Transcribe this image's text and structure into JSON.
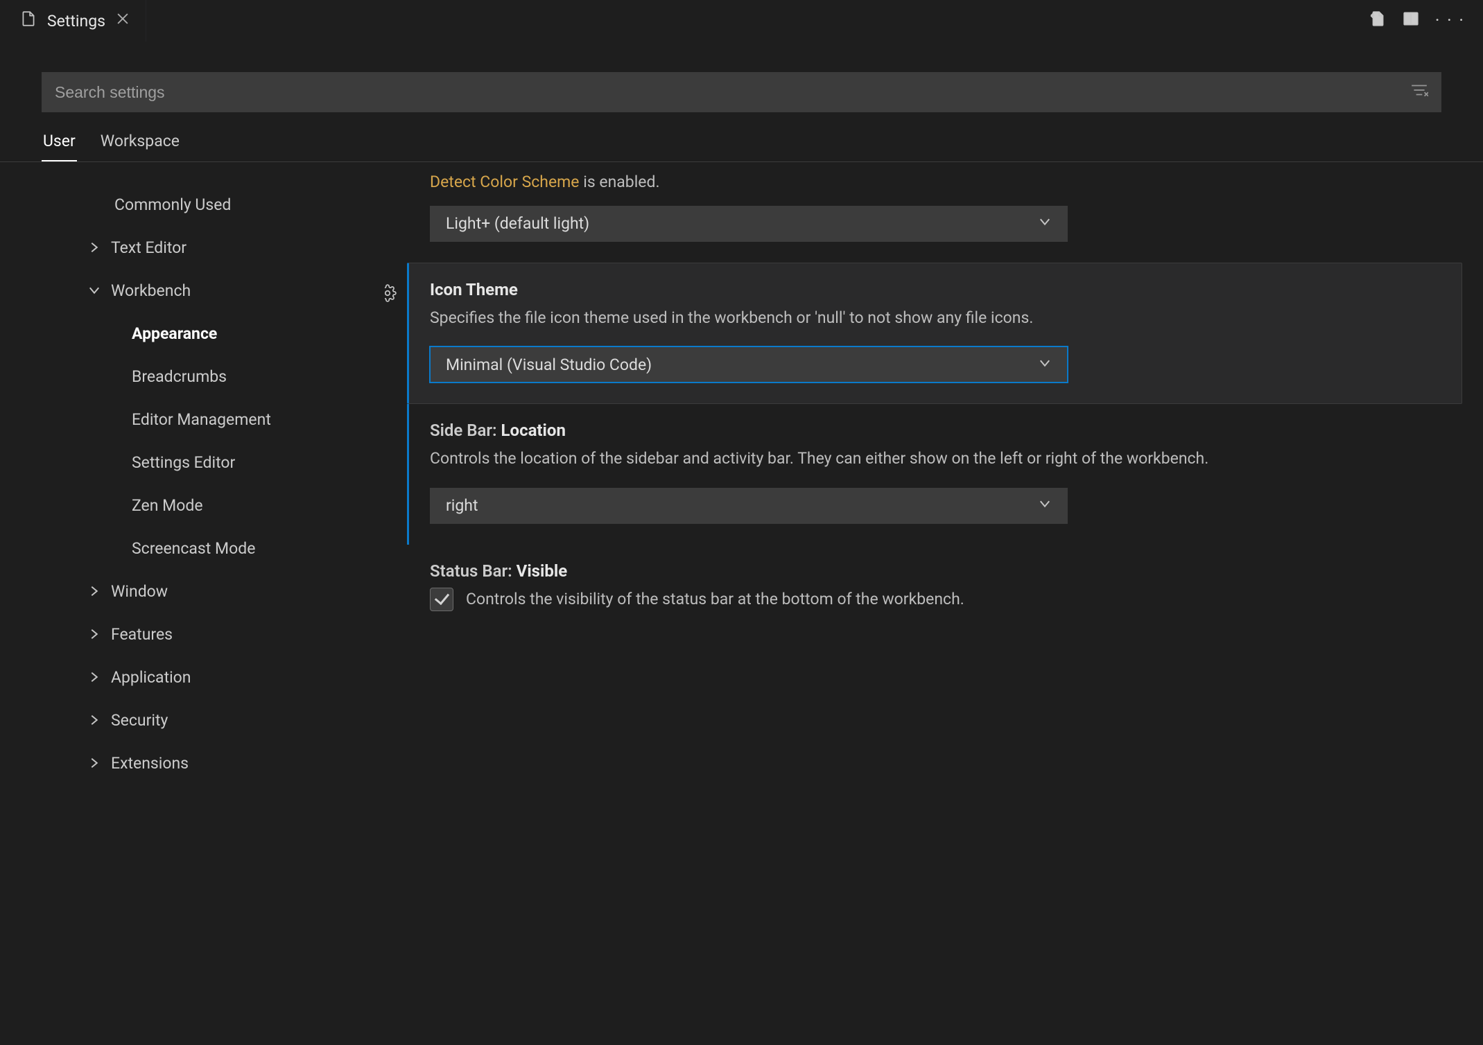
{
  "tab": {
    "title": "Settings"
  },
  "search": {
    "placeholder": "Search settings"
  },
  "scope": {
    "user": "User",
    "workspace": "Workspace"
  },
  "tree": {
    "commonly_used": "Commonly Used",
    "text_editor": "Text Editor",
    "workbench": "Workbench",
    "appearance": "Appearance",
    "breadcrumbs": "Breadcrumbs",
    "editor_management": "Editor Management",
    "settings_editor": "Settings Editor",
    "zen_mode": "Zen Mode",
    "screencast_mode": "Screencast Mode",
    "window": "Window",
    "features": "Features",
    "application": "Application",
    "security": "Security",
    "extensions": "Extensions"
  },
  "settings": {
    "light_theme": {
      "link_text": "Detect Color Scheme",
      "desc_tail": " is enabled.",
      "value": "Light+ (default light)"
    },
    "icon_theme": {
      "title": "Icon Theme",
      "desc": "Specifies the file icon theme used in the workbench or 'null' to not show any file icons.",
      "value": "Minimal (Visual Studio Code)"
    },
    "sidebar_location": {
      "title_prefix": "Side Bar: ",
      "title_main": "Location",
      "desc": "Controls the location of the sidebar and activity bar. They can either show on the left or right of the workbench.",
      "value": "right"
    },
    "status_bar": {
      "title_prefix": "Status Bar: ",
      "title_main": "Visible",
      "desc": "Controls the visibility of the status bar at the bottom of the workbench.",
      "checked": true
    }
  }
}
